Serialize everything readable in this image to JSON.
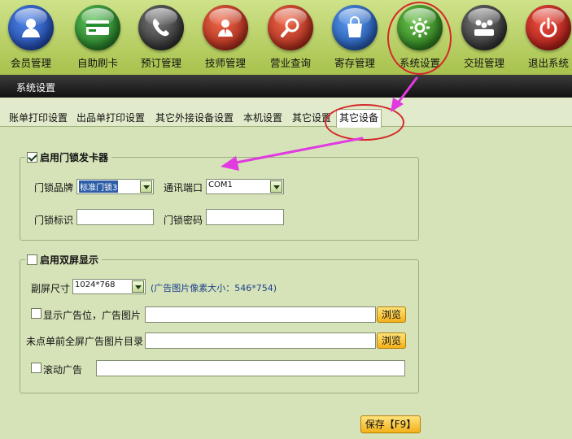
{
  "toolbar": {
    "items": [
      {
        "label": "会员管理",
        "icon": "member-icon",
        "color": "#1a4fbf"
      },
      {
        "label": "自助刷卡",
        "icon": "card-icon",
        "color": "#1e8a2a"
      },
      {
        "label": "预订管理",
        "icon": "phone-icon",
        "color": "#2b2b2b"
      },
      {
        "label": "技师管理",
        "icon": "technician-icon",
        "color": "#c8301f"
      },
      {
        "label": "营业查询",
        "icon": "search-icon",
        "color": "#c8301f"
      },
      {
        "label": "寄存管理",
        "icon": "bag-icon",
        "color": "#1f5fc4"
      },
      {
        "label": "系统设置",
        "icon": "gear-icon",
        "color": "#2f8f1f"
      },
      {
        "label": "交班管理",
        "icon": "handover-icon",
        "color": "#2b2b2b"
      },
      {
        "label": "退出系统",
        "icon": "power-icon",
        "color": "#c8201f"
      }
    ]
  },
  "window": {
    "title": "系统设置"
  },
  "tabs": [
    {
      "label": "账单打印设置"
    },
    {
      "label": "出品单打印设置"
    },
    {
      "label": "其它外接设备设置"
    },
    {
      "label": "本机设置"
    },
    {
      "label": "其它设置"
    },
    {
      "label": "其它设备",
      "active": true
    }
  ],
  "door_lock": {
    "legend": "启用门锁发卡器",
    "enabled": true,
    "brand_label": "门锁品牌",
    "brand_value": "标准门锁3",
    "port_label": "通讯端口",
    "port_value": "COM1",
    "id_label": "门锁标识",
    "id_value": "",
    "password_label": "门锁密码",
    "password_value": ""
  },
  "dual_screen": {
    "legend": "启用双屏显示",
    "enabled": false,
    "size_label": "副屏尺寸",
    "size_value": "1024*768",
    "size_hint": "(广告图片像素大小：546*754)",
    "ad_slot_label": "显示广告位，广告图片",
    "ad_slot_checked": false,
    "ad_slot_value": "",
    "browse_label": "浏览",
    "fullscreen_label": "未点单前全屏广告图片目录",
    "fullscreen_value": "",
    "scroll_label": "滚动广告",
    "scroll_checked": false,
    "scroll_value": ""
  },
  "save_label": "保存【F9】",
  "colors": {
    "highlight_ring": "#d4282a",
    "annotation_arrow": "#e03ae0",
    "panel_bg": "#d6e3b8"
  }
}
